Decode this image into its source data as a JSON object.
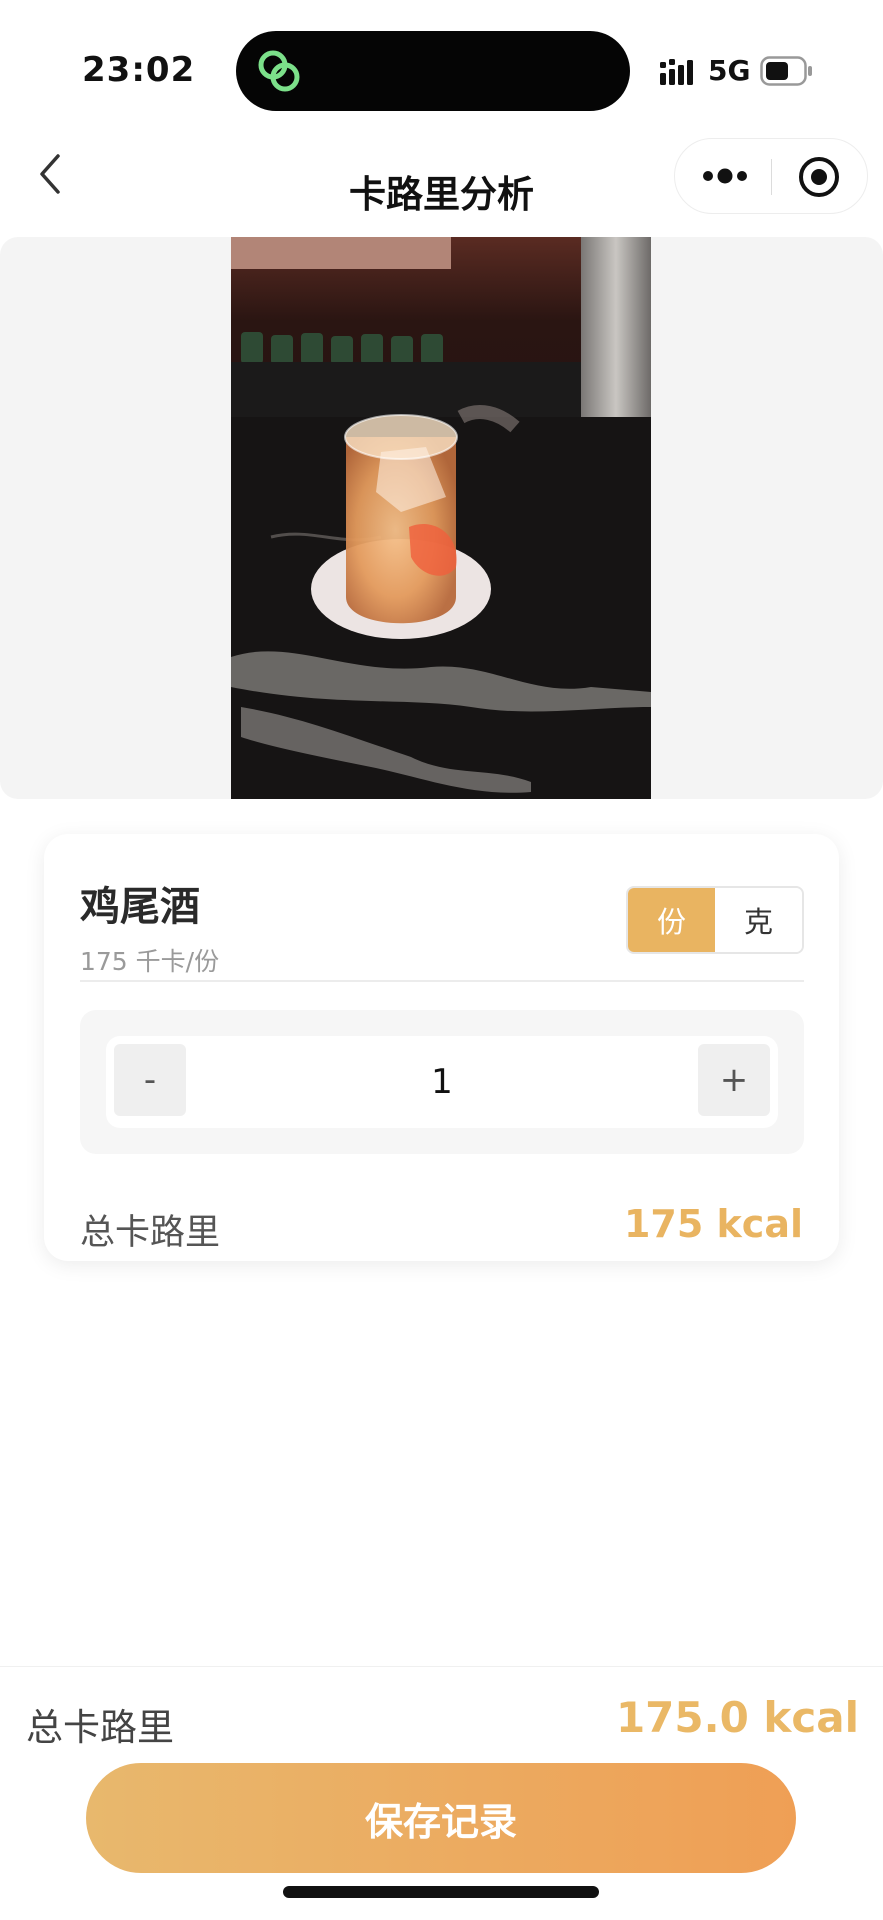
{
  "status_bar": {
    "time": "23:02",
    "network": "5G",
    "icons": [
      "wechat-link-icon",
      "signal-icon",
      "battery-icon"
    ]
  },
  "nav": {
    "title": "卡路里分析",
    "icons": [
      "back-icon",
      "more-icon",
      "target-icon"
    ]
  },
  "photo": {
    "description_icon": "food-photo"
  },
  "food_card": {
    "name": "鸡尾酒",
    "subtitle": "175 千卡/份",
    "unit_options": [
      "份",
      "克"
    ],
    "selected_unit": "份",
    "minus_label": "-",
    "plus_label": "+",
    "quantity": "1",
    "total_label": "总卡路里",
    "total_value": "175 kcal"
  },
  "bottom_bar": {
    "total_label": "总卡路里",
    "total_value": "175.0 kcal",
    "save_label": "保存记录"
  },
  "colors": {
    "accent": "#e9b461",
    "button_gradient_start": "#e8b86d",
    "button_gradient_end": "#ef9f55",
    "island_icon": "#7ce08a"
  }
}
